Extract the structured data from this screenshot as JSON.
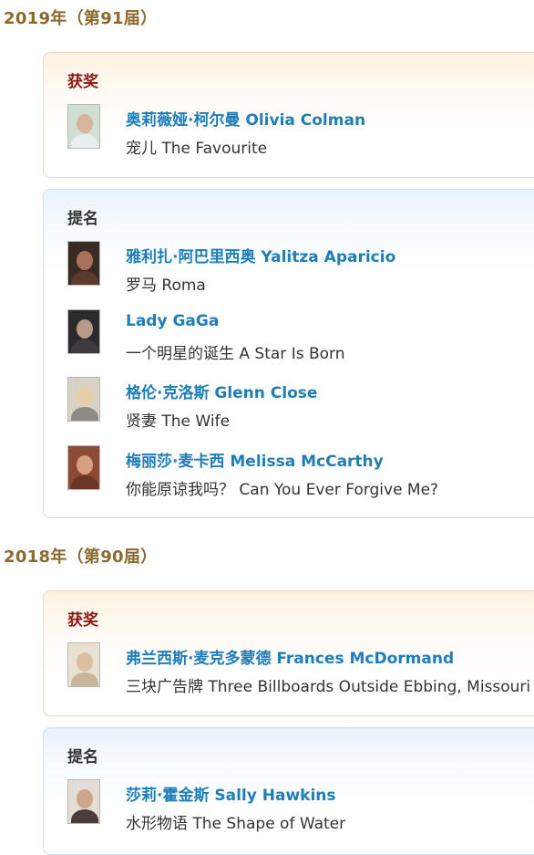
{
  "years": [
    {
      "heading": "2019年（第91届）",
      "winner": {
        "label": "获奖",
        "entries": [
          {
            "name": "奥莉薇娅·柯尔曼 Olivia Colman",
            "film": "宠儿 The Favourite"
          }
        ]
      },
      "nominees": {
        "label": "提名",
        "entries": [
          {
            "name": "雅利扎·阿巴里西奥 Yalitza Aparicio",
            "film": "罗马 Roma"
          },
          {
            "name": "Lady GaGa",
            "film": "一个明星的诞生 A Star Is Born"
          },
          {
            "name": "格伦·克洛斯 Glenn Close",
            "film": "贤妻 The Wife"
          },
          {
            "name": "梅丽莎·麦卡西 Melissa McCarthy",
            "film": "你能原谅我吗？  Can You Ever Forgive Me?"
          }
        ]
      }
    },
    {
      "heading": "2018年（第90届）",
      "winner": {
        "label": "获奖",
        "entries": [
          {
            "name": "弗兰西斯·麦克多蒙德 Frances McDormand",
            "film": "三块广告牌 Three Billboards Outside Ebbing, Missouri"
          }
        ]
      },
      "nominees": {
        "label": "提名",
        "entries": [
          {
            "name": "莎莉·霍金斯 Sally Hawkins",
            "film": "水形物语 The Shape of Water"
          }
        ]
      }
    }
  ]
}
